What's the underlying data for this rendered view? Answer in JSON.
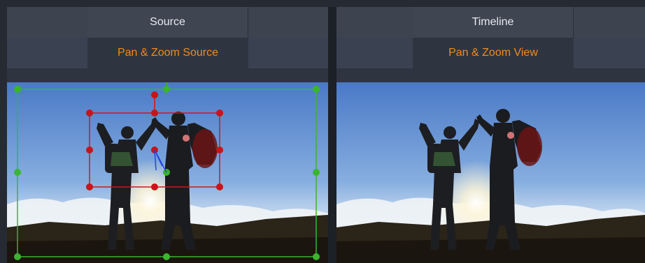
{
  "source_panel": {
    "tab_label": "Source",
    "subtab_label": "Pan & Zoom Source"
  },
  "timeline_panel": {
    "tab_label": "Timeline",
    "subtab_label": "Pan & Zoom View"
  },
  "colors": {
    "panel_bg": "#2d323b",
    "tab_bg": "#3f4652",
    "subtab_text": "#f08a1e",
    "frame_green": "#3bb52d",
    "frame_red": "#d0161b",
    "vector_blue": "#2244e0"
  },
  "icons": [
    "green-frame-handle",
    "red-frame-handle",
    "rotation-handle",
    "center-anchor"
  ]
}
